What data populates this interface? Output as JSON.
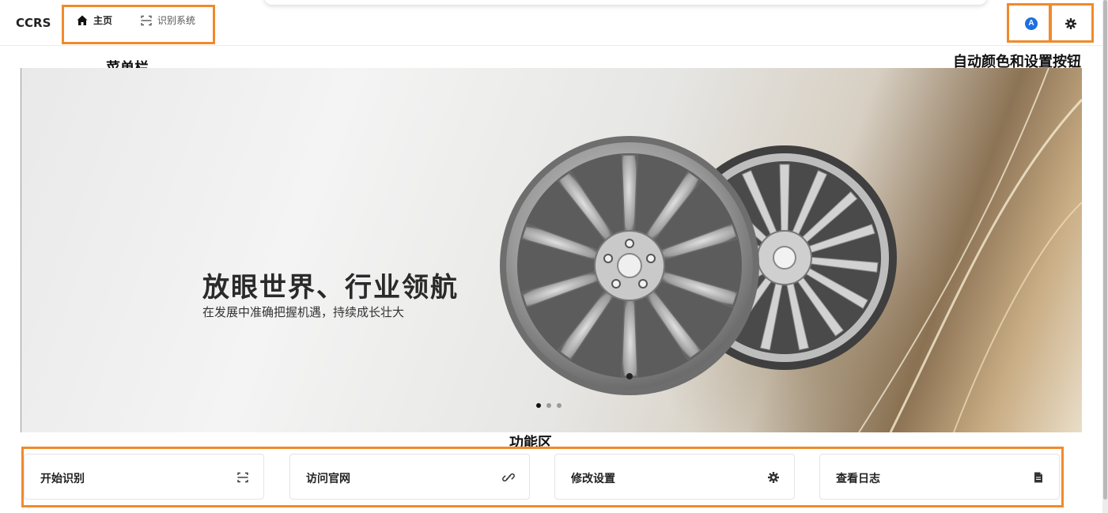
{
  "app": {
    "logo": "CCRS"
  },
  "nav": {
    "items": [
      {
        "label": "主页",
        "icon": "home-icon",
        "active": true
      },
      {
        "label": "识别系统",
        "icon": "scan-icon",
        "active": false
      }
    ]
  },
  "header_actions": {
    "color_mode": {
      "icon": "auto-color-icon",
      "glyph": "A"
    },
    "settings": {
      "icon": "gear-icon"
    }
  },
  "annotations": {
    "menu_bar": "菜单栏",
    "right_actions": "自动颜色和设置按钮",
    "function_area": "功能区"
  },
  "banner": {
    "title": "放眼世界、行业领航",
    "subtitle": "在发展中准确把握机遇，持续成长壮大",
    "slides": 3,
    "active_slide": 1
  },
  "features": [
    {
      "label": "开始识别",
      "icon": "scan-icon"
    },
    {
      "label": "访问官网",
      "icon": "link-icon"
    },
    {
      "label": "修改设置",
      "icon": "gear-icon"
    },
    {
      "label": "查看日志",
      "icon": "document-icon"
    }
  ],
  "colors": {
    "annotation": "#f08a2c",
    "accent_blue": "#1e6fe0"
  }
}
